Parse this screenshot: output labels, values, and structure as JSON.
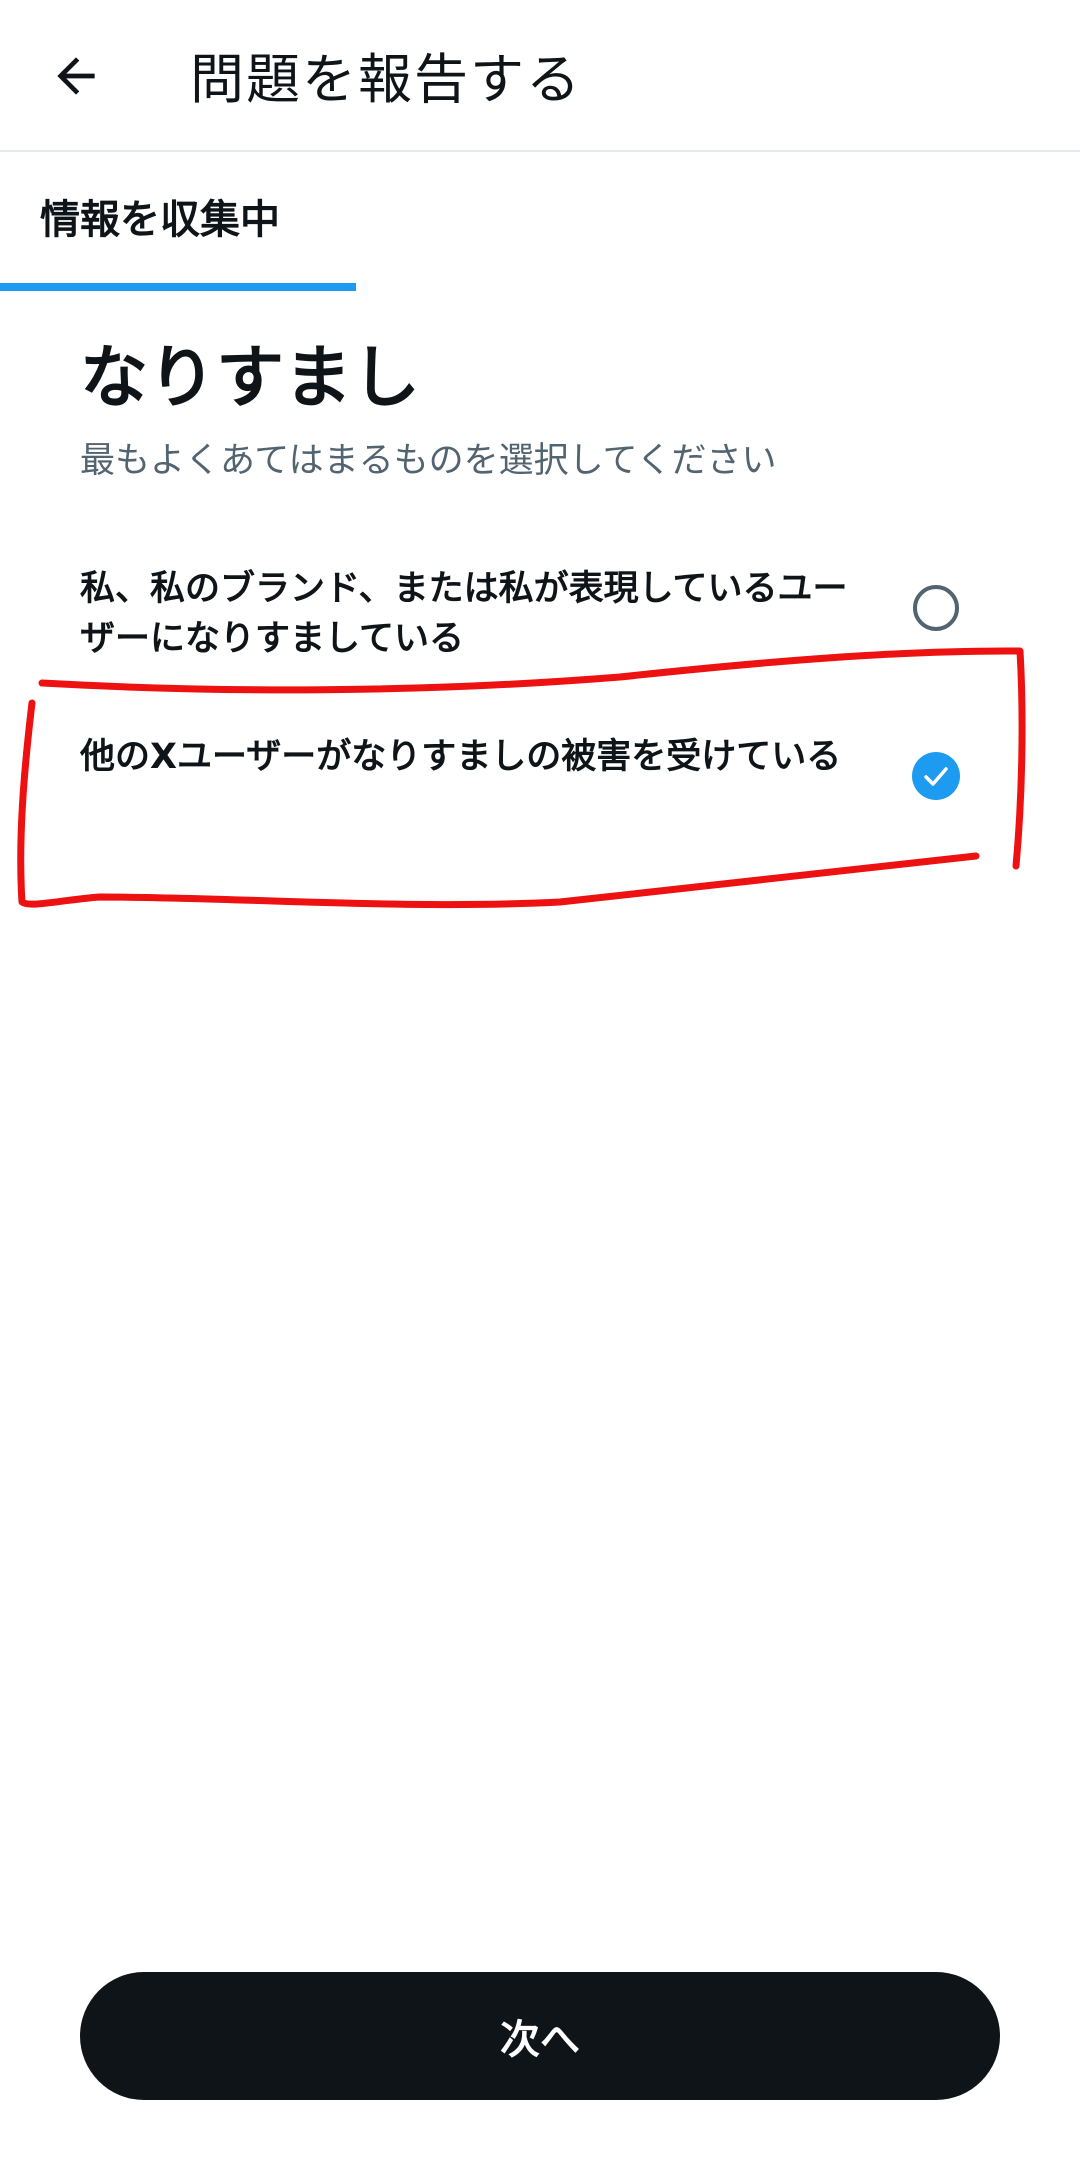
{
  "header": {
    "back_icon": "arrow-left-icon",
    "title": "問題を報告する"
  },
  "tab": {
    "label": "情報を収集中",
    "progress": 0.33,
    "accent": "#1d9bf0"
  },
  "main": {
    "title": "なりすまし",
    "subtitle": "最もよくあてはまるものを選択してください",
    "options": [
      {
        "label": "私、私のブランド、または私が表現しているユーザーになりすましている",
        "selected": false,
        "icon": "radio-unchecked-icon"
      },
      {
        "label": "他のXユーザーがなりすましの被害を受けている",
        "selected": true,
        "icon": "radio-checked-icon"
      }
    ]
  },
  "footer": {
    "next_label": "次へ"
  },
  "colors": {
    "text": "#0f1419",
    "secondary_text": "#536471",
    "accent": "#1d9bf0",
    "button_bg": "#0f1419",
    "annotation": "#ee1111"
  }
}
